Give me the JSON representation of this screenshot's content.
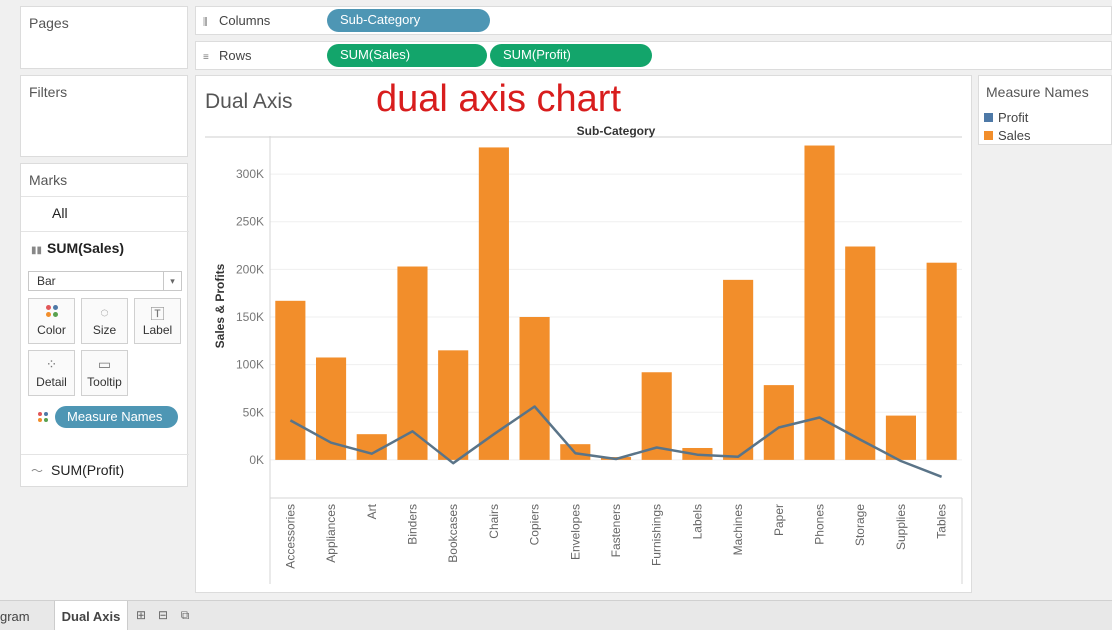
{
  "panels": {
    "pages_title": "Pages",
    "filters_title": "Filters",
    "marks_title": "Marks"
  },
  "marks": {
    "all_label": "All",
    "sales_card_label": "SUM(Sales)",
    "mark_type": "Bar",
    "buttons": {
      "color": "Color",
      "size": "Size",
      "label": "Label",
      "detail": "Detail",
      "tooltip": "Tooltip"
    },
    "color_pill": "Measure Names",
    "profit_card_label": "SUM(Profit)"
  },
  "shelves": {
    "columns_label": "Columns",
    "rows_label": "Rows",
    "columns_pill": "Sub-Category",
    "rows_pills": [
      "SUM(Sales)",
      "SUM(Profit)"
    ]
  },
  "sheet": {
    "title": "Dual Axis",
    "annotation": "dual axis chart"
  },
  "legend": {
    "title": "Measure Names",
    "items": [
      {
        "label": "Profit",
        "color": "#4e79a7"
      },
      {
        "label": "Sales",
        "color": "#f28e2b"
      }
    ]
  },
  "tabs": {
    "previous": "gram",
    "active": "Dual Axis"
  },
  "colors": {
    "sales_bar": "#f28e2b",
    "profit_line": "#5a7488",
    "pill_dimension": "#4e96b4",
    "pill_measure": "#13a56b",
    "annotation": "#d81d1d"
  },
  "chart_data": {
    "type": "bar",
    "combo": "bar + line (dual axis)",
    "header": "Sub-Category",
    "ylabel": "Sales & Profits",
    "ylim": [
      -40000,
      340000
    ],
    "yticks": [
      0,
      50000,
      100000,
      150000,
      200000,
      250000,
      300000
    ],
    "ytick_labels": [
      "0K",
      "50K",
      "100K",
      "150K",
      "200K",
      "250K",
      "300K"
    ],
    "gridlines": true,
    "categories": [
      "Accessories",
      "Appliances",
      "Art",
      "Binders",
      "Bookcases",
      "Chairs",
      "Copiers",
      "Envelopes",
      "Fasteners",
      "Furnishings",
      "Labels",
      "Machines",
      "Paper",
      "Phones",
      "Storage",
      "Supplies",
      "Tables"
    ],
    "series": [
      {
        "name": "Sales",
        "type": "bar",
        "values": [
          167000,
          107500,
          27000,
          203000,
          115000,
          328000,
          150000,
          16500,
          3000,
          92000,
          12500,
          189000,
          78500,
          330000,
          224000,
          46500,
          207000
        ]
      },
      {
        "name": "Profit",
        "type": "line",
        "values": [
          41500,
          18000,
          6500,
          30000,
          -3500,
          27000,
          56000,
          7000,
          950,
          13000,
          5500,
          3400,
          34000,
          44500,
          21300,
          -1200,
          -17700
        ]
      }
    ]
  }
}
